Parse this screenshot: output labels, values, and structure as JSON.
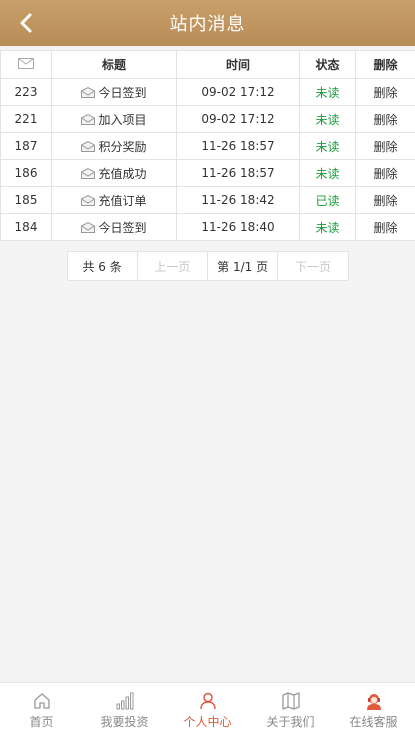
{
  "header": {
    "title": "站内消息"
  },
  "table": {
    "headers": {
      "title": "标题",
      "time": "时间",
      "status": "状态",
      "delete": "删除"
    },
    "rows": [
      {
        "id": "223",
        "title": "今日签到",
        "time": "09-02 17:12",
        "status": "未读",
        "delete": "删除"
      },
      {
        "id": "221",
        "title": "加入项目",
        "time": "09-02 17:12",
        "status": "未读",
        "delete": "删除"
      },
      {
        "id": "187",
        "title": "积分奖励",
        "time": "11-26 18:57",
        "status": "未读",
        "delete": "删除"
      },
      {
        "id": "186",
        "title": "充值成功",
        "time": "11-26 18:57",
        "status": "未读",
        "delete": "删除"
      },
      {
        "id": "185",
        "title": "充值订单",
        "time": "11-26 18:42",
        "status": "已读",
        "delete": "删除"
      },
      {
        "id": "184",
        "title": "今日签到",
        "time": "11-26 18:40",
        "status": "未读",
        "delete": "删除"
      }
    ]
  },
  "pager": {
    "total": "共 6 条",
    "prev": "上一页",
    "current": "第 1/1 页",
    "next": "下一页"
  },
  "tabbar": {
    "home": "首页",
    "invest": "我要投资",
    "profile": "个人中心",
    "about": "关于我们",
    "service": "在线客服"
  },
  "colors": {
    "header": "#c29a63",
    "active_tab": "#e0593c",
    "status": "#1a9e3a"
  }
}
